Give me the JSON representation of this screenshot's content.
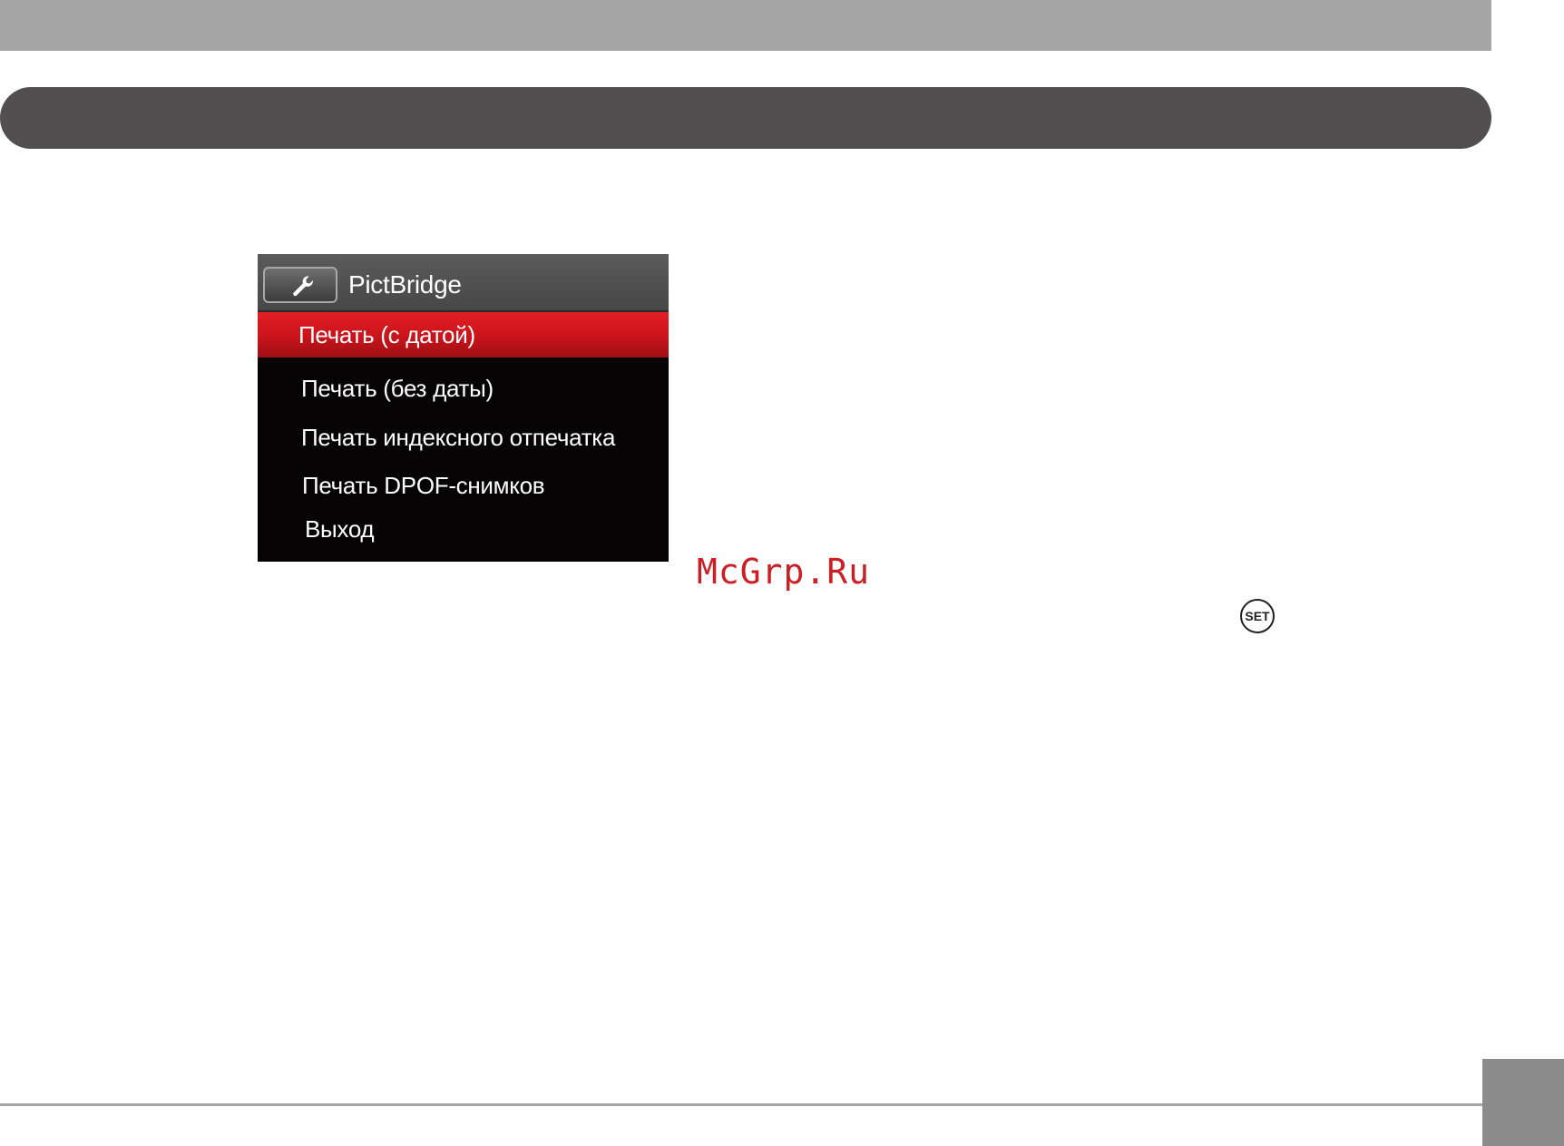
{
  "camera_menu": {
    "tab_icon": "wrench-icon",
    "title": "PictBridge",
    "items": [
      {
        "label": "Печать (с датой)",
        "selected": true
      },
      {
        "label": "Печать (без даты)",
        "selected": false
      },
      {
        "label": "Печать индексного отпечатка",
        "selected": false
      },
      {
        "label": "Печать DPOF-снимков",
        "selected": false
      },
      {
        "label": "Выход",
        "selected": false
      }
    ]
  },
  "watermark": "McGrp.Ru",
  "set_button": {
    "label": "SET"
  },
  "colors": {
    "header_bar": "#514f50",
    "top_band": "#a7a6a6",
    "selection": "#d8191f",
    "watermark": "#cc1f25",
    "page_tab": "#8c8b8b"
  }
}
